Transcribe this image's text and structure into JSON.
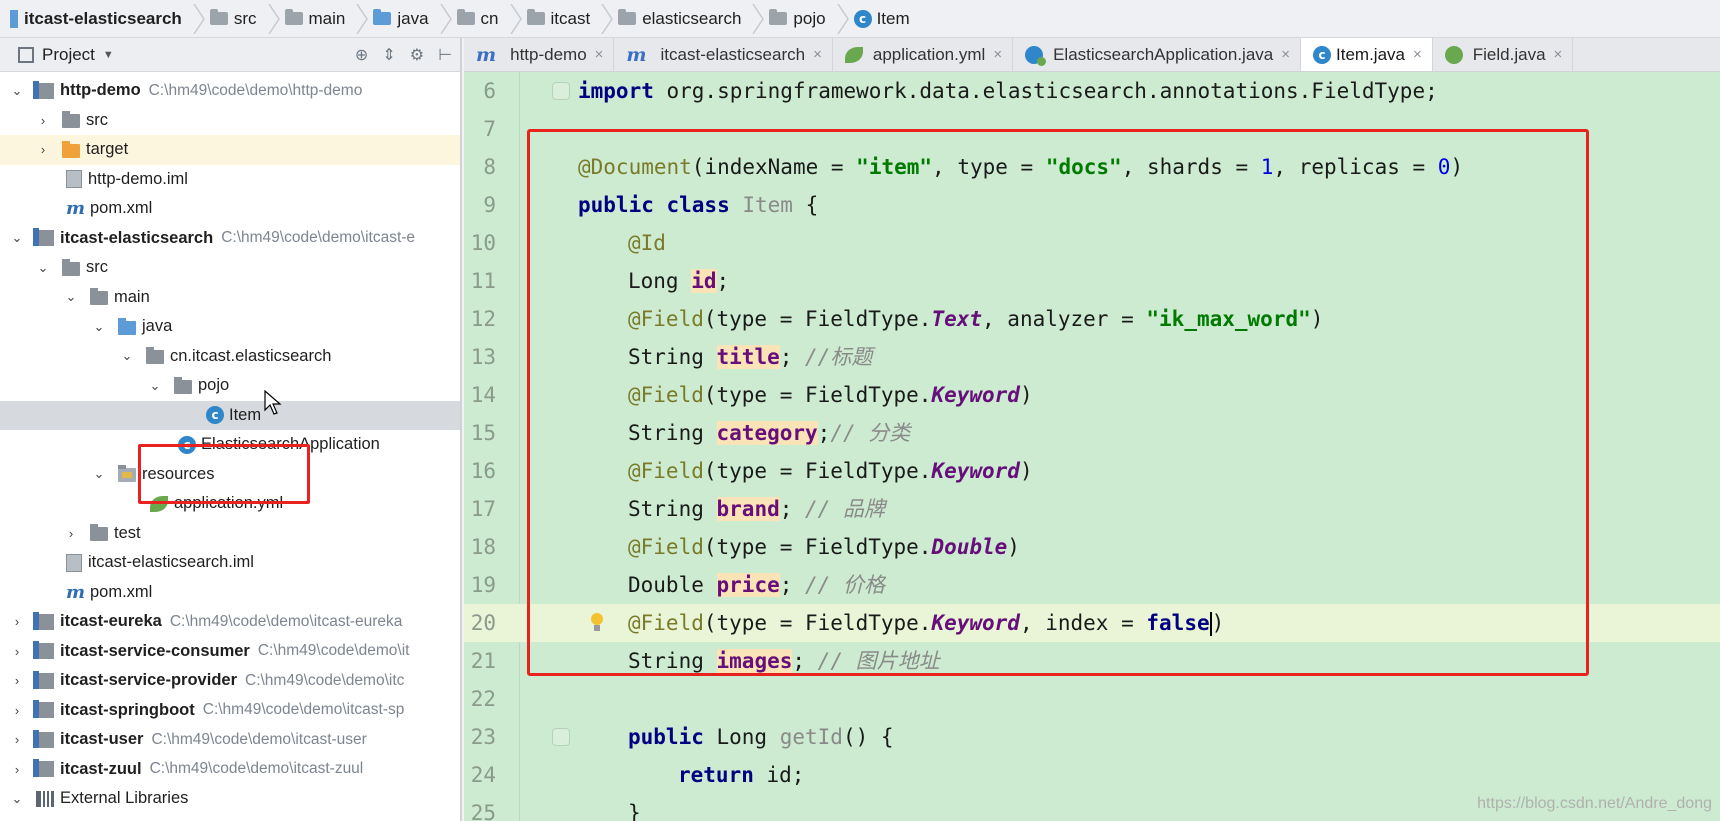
{
  "breadcrumb": [
    {
      "label": "itcast-elasticsearch",
      "icon": "module-icon"
    },
    {
      "label": "src",
      "icon": "folder-icon"
    },
    {
      "label": "main",
      "icon": "folder-icon"
    },
    {
      "label": "java",
      "icon": "folder-icon"
    },
    {
      "label": "cn",
      "icon": "package-icon"
    },
    {
      "label": "itcast",
      "icon": "package-icon"
    },
    {
      "label": "elasticsearch",
      "icon": "package-icon"
    },
    {
      "label": "pojo",
      "icon": "package-icon"
    },
    {
      "label": "Item",
      "icon": "class-icon"
    }
  ],
  "project_panel": {
    "title": "Project",
    "tree": [
      {
        "label": "http-demo",
        "path": "C:\\hm49\\code\\demo\\http-demo"
      },
      {
        "label": "src"
      },
      {
        "label": "target"
      },
      {
        "label": "http-demo.iml"
      },
      {
        "label": "pom.xml"
      },
      {
        "label": "itcast-elasticsearch",
        "path": "C:\\hm49\\code\\demo\\itcast-e"
      },
      {
        "label": "src"
      },
      {
        "label": "main"
      },
      {
        "label": "java"
      },
      {
        "label": "cn.itcast.elasticsearch"
      },
      {
        "label": "pojo"
      },
      {
        "label": "Item"
      },
      {
        "label": "ElasticsearchApplication"
      },
      {
        "label": "resources"
      },
      {
        "label": "application.yml"
      },
      {
        "label": "test"
      },
      {
        "label": "itcast-elasticsearch.iml"
      },
      {
        "label": "pom.xml"
      },
      {
        "label": "itcast-eureka",
        "path": "C:\\hm49\\code\\demo\\itcast-eureka"
      },
      {
        "label": "itcast-service-consumer",
        "path": "C:\\hm49\\code\\demo\\it"
      },
      {
        "label": "itcast-service-provider",
        "path": "C:\\hm49\\code\\demo\\itc"
      },
      {
        "label": "itcast-springboot",
        "path": "C:\\hm49\\code\\demo\\itcast-sp"
      },
      {
        "label": "itcast-user",
        "path": "C:\\hm49\\code\\demo\\itcast-user"
      },
      {
        "label": "itcast-zuul",
        "path": "C:\\hm49\\code\\demo\\itcast-zuul"
      },
      {
        "label": "External Libraries"
      }
    ]
  },
  "tabs": [
    {
      "label": "http-demo",
      "icon": "maven-icon"
    },
    {
      "label": "itcast-elasticsearch",
      "icon": "maven-icon"
    },
    {
      "label": "application.yml",
      "icon": "yaml-icon"
    },
    {
      "label": "ElasticsearchApplication.java",
      "icon": "spring-app-icon"
    },
    {
      "label": "Item.java",
      "icon": "class-icon",
      "active": true
    },
    {
      "label": "Field.java",
      "icon": "annotation-icon"
    }
  ],
  "editor": {
    "line_numbers": [
      "6",
      "7",
      "8",
      "9",
      "10",
      "11",
      "12",
      "13",
      "14",
      "15",
      "16",
      "17",
      "18",
      "19",
      "20",
      "21",
      "22",
      "23",
      "24",
      "25"
    ],
    "l6": {
      "kw": "import",
      "rest": " org.springframework.data.elasticsearch.annotations.FieldType;"
    },
    "l8": {
      "ann": "@Document",
      "a": "(indexName = ",
      "s1": "\"item\"",
      "b": ", type = ",
      "s2": "\"docs\"",
      "c": ", shards = ",
      "n1": "1",
      "d": ", replicas = ",
      "n2": "0",
      "e": ")"
    },
    "l9": {
      "kw": "public class",
      "name": " Item",
      "rest": " {"
    },
    "l10": {
      "ann": "@Id"
    },
    "l11": {
      "type": "Long ",
      "name": "id",
      "rest": ";"
    },
    "l12": {
      "ann": "@Field",
      "a": "(type = FieldType.",
      "it": "Text",
      "b": ", analyzer = ",
      "s": "\"ik_max_word\"",
      "c": ")"
    },
    "l13": {
      "type": "String ",
      "name": "title",
      "rest": "; ",
      "cmt": "//标题"
    },
    "l14": {
      "ann": "@Field",
      "a": "(type = FieldType.",
      "it": "Keyword",
      "c": ")"
    },
    "l15": {
      "type": "String ",
      "name": "category",
      "rest": ";",
      "cmt": "// 分类"
    },
    "l16": {
      "ann": "@Field",
      "a": "(type = FieldType.",
      "it": "Keyword",
      "c": ")"
    },
    "l17": {
      "type": "String ",
      "name": "brand",
      "rest": "; ",
      "cmt": "// 品牌"
    },
    "l18": {
      "ann": "@Field",
      "a": "(type = FieldType.",
      "it": "Double",
      "c": ")"
    },
    "l19": {
      "type": "Double ",
      "name": "price",
      "rest": "; ",
      "cmt": "// 价格"
    },
    "l20": {
      "ann": "@Field",
      "a": "(type = FieldType.",
      "it": "Keyword",
      "b": ", index = ",
      "kw": "false",
      "c": ")"
    },
    "l21": {
      "type": "String ",
      "name": "images",
      "rest": "; ",
      "cmt": "// 图片地址"
    },
    "l23": {
      "kw": "public",
      "type": " Long ",
      "name": "getId",
      "rest": "() {"
    },
    "l24": {
      "kw": "return",
      "rest": " id;"
    },
    "l25": {
      "rest": "}"
    }
  },
  "watermark": "https://blog.csdn.net/Andre_dong"
}
